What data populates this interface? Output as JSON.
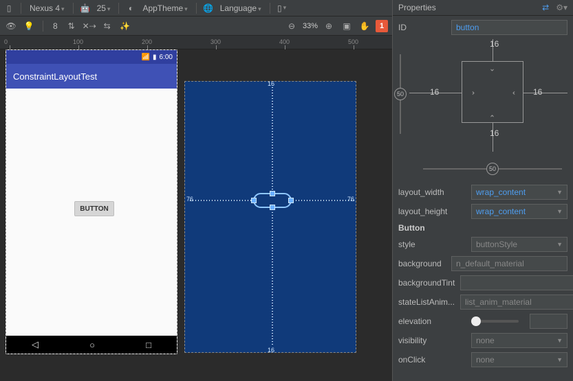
{
  "toolbar1": {
    "device": "Nexus 4",
    "api": "25",
    "theme": "AppTheme",
    "language": "Language"
  },
  "toolbar2": {
    "autoconnect_value": "8",
    "zoom_percent": "33%",
    "warning_count": "1"
  },
  "ruler": {
    "ticks": [
      "0",
      "100",
      "200",
      "300",
      "400",
      "500"
    ]
  },
  "design": {
    "time": "6:00",
    "app_title": "ConstraintLayoutTest",
    "button_label": "BUTTON"
  },
  "blueprint": {
    "margin_top": "16",
    "margin_bottom": "16",
    "margin_left": "76",
    "margin_right": "76"
  },
  "properties": {
    "panel_title": "Properties",
    "id_label": "ID",
    "id_value": "button",
    "constraint": {
      "top": "16",
      "bottom": "16",
      "left": "16",
      "right": "16",
      "bias_v": "50",
      "bias_h": "50"
    },
    "layout_width_label": "layout_width",
    "layout_width_value": "wrap_content",
    "layout_height_label": "layout_height",
    "layout_height_value": "wrap_content",
    "section_button": "Button",
    "style_label": "style",
    "style_value": "buttonStyle",
    "background_label": "background",
    "background_value": "n_default_material",
    "backgroundTint_label": "backgroundTint",
    "backgroundTint_value": "",
    "stateListAnim_label": "stateListAnim...",
    "stateListAnim_value": "list_anim_material",
    "elevation_label": "elevation",
    "visibility_label": "visibility",
    "visibility_value": "none",
    "onClick_label": "onClick",
    "onClick_value": "none"
  }
}
